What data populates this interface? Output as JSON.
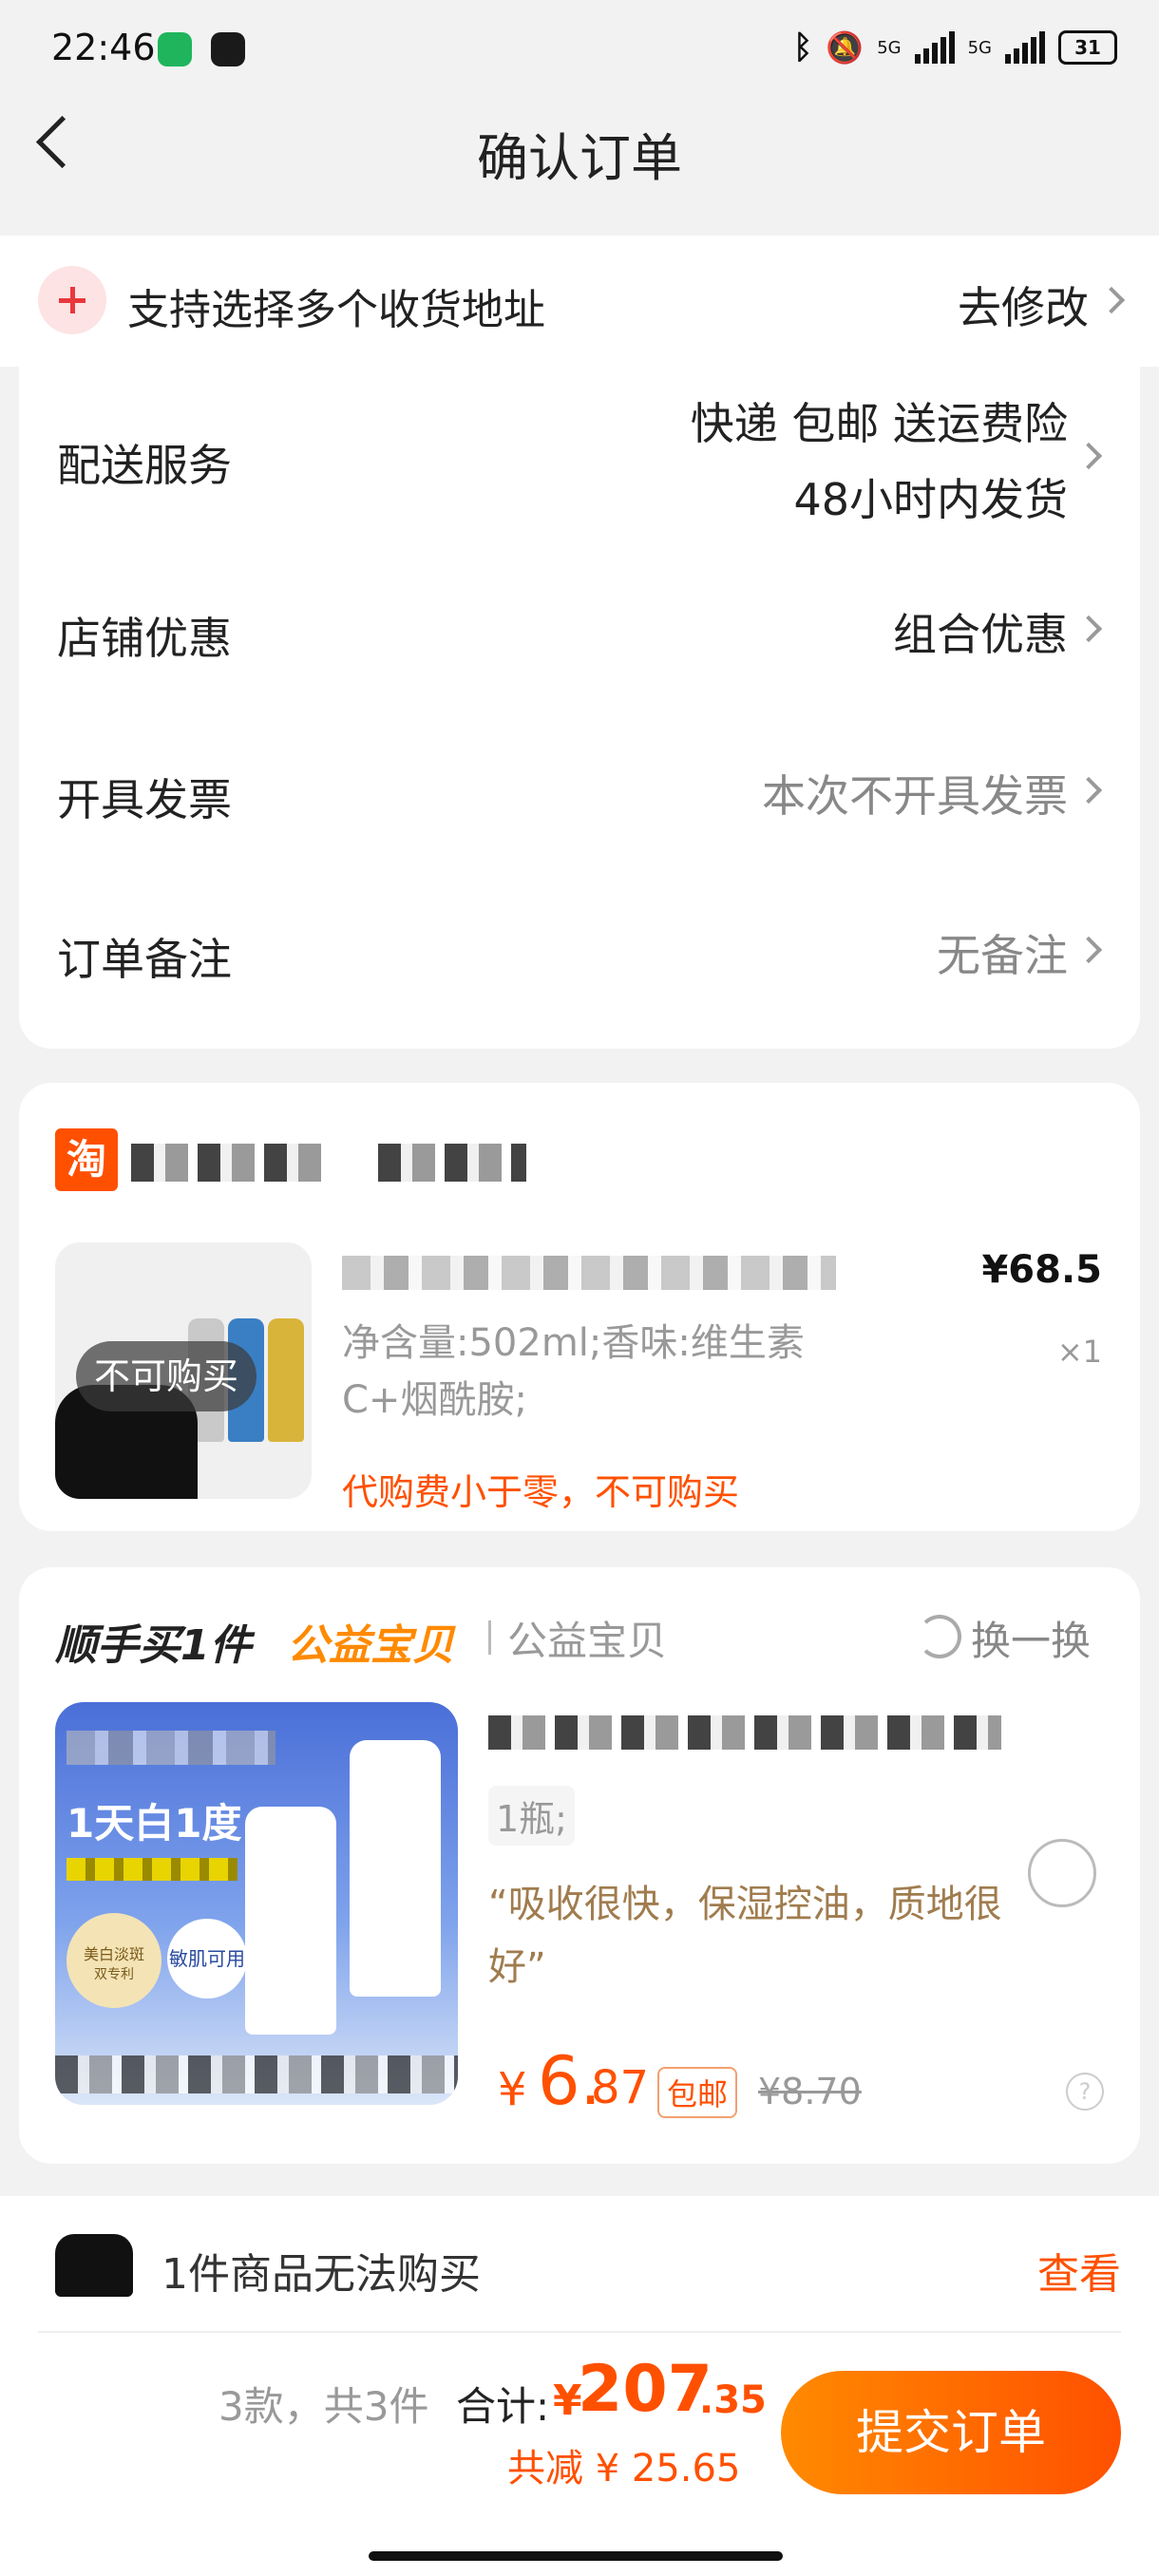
{
  "status_bar": {
    "time": "22:46",
    "net1": "5G",
    "net2": "5G",
    "battery": "31"
  },
  "header": {
    "title": "确认订单"
  },
  "address_banner": {
    "text": "支持选择多个收货地址",
    "action": "去修改"
  },
  "order_info": {
    "delivery": {
      "label": "配送服务",
      "line1": "快递 包邮 送运费险",
      "line2": "48小时内发货"
    },
    "shop_discount": {
      "label": "店铺优惠",
      "value": "组合优惠"
    },
    "invoice": {
      "label": "开具发票",
      "value": "本次不开具发票"
    },
    "remark": {
      "label": "订单备注",
      "value": "无备注"
    }
  },
  "shop": {
    "logo_text": "淘",
    "product": {
      "spec": "净含量:502ml;香味:维生素C+烟酰胺;",
      "price": "¥68.5",
      "quantity": "×1",
      "unavailable_tag": "不可购买",
      "warning": "代购费小于零，不可购买"
    }
  },
  "recommend": {
    "title": "顺手买1件",
    "highlight": "公益宝贝",
    "subtitle": "公益宝贝",
    "refresh": "换一换",
    "image_text": "1天白1度",
    "image_badge1": "美白淡斑",
    "image_badge2": "敏肌可用",
    "image_badge3": "双专利",
    "product": {
      "spec": "1瓶;",
      "review": "“吸收很快，保湿控油，质地很好”",
      "price_symbol": "¥",
      "price_int": "6.",
      "price_dec": "87",
      "free_shipping": "包邮",
      "original_price": "¥8.70"
    }
  },
  "unavailable_bar": {
    "text": "1件商品无法购买",
    "action": "查看"
  },
  "checkout": {
    "count": "3款，共3件",
    "total_label": "合计:",
    "total_symbol": "¥",
    "total_int": "207",
    "total_dec": ".35",
    "discount": "共减 ¥ 25.65",
    "submit": "提交订单"
  }
}
